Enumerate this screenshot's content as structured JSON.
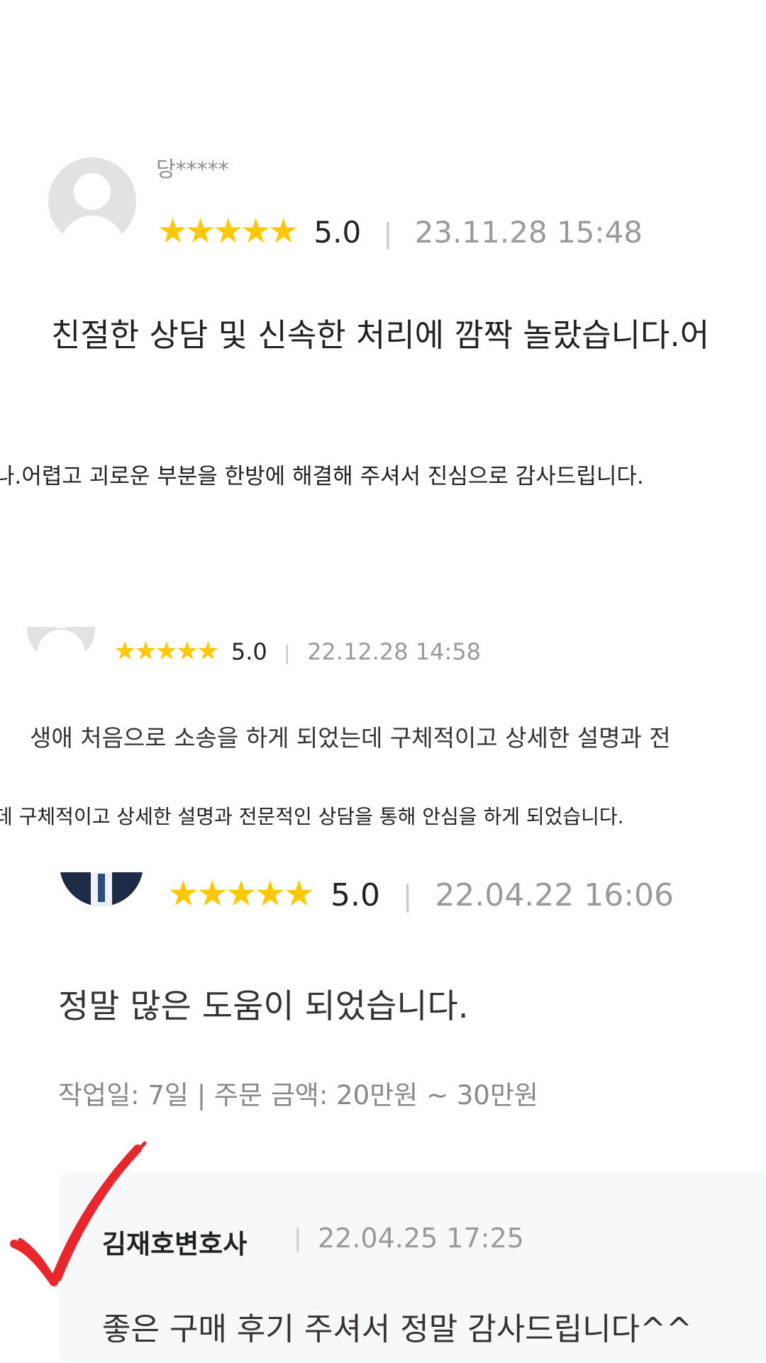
{
  "reviews": [
    {
      "username": "당*****",
      "stars": "★★★★★",
      "rating": "5.0",
      "separator": "|",
      "date": "23.11.28 15:48",
      "text": "친절한 상담 및 신속한 처리에 깜짝 놀랐습니다.어",
      "text_continued": "나.어렵고 괴로운 부분을 한방에 해결해 주셔서 진심으로 감사드립니다."
    },
    {
      "stars": "★★★★★",
      "rating": "5.0",
      "separator": "|",
      "date": "22.12.28 14:58",
      "text": "생애 처음으로 소송을 하게 되었는데 구체적이고 상세한 설명과 전",
      "text_continued": "데 구체적이고 상세한 설명과 전문적인 상담을 통해 안심을 하게 되었습니다."
    },
    {
      "stars": "★★★★★",
      "rating": "5.0",
      "separator": "|",
      "date": "22.04.22 16:06",
      "text": "정말 많은 도움이 되었습니다.",
      "meta": "작업일: 7일 | 주문 금액: 20만원 ~ 30만원",
      "reply": {
        "author": "김재호변호사",
        "separator": "|",
        "date": "22.04.25 17:25",
        "text": "좋은 구매 후기 주셔서 정말 감사드립니다^^"
      }
    }
  ],
  "colors": {
    "star": "#FFC800",
    "check": "#E8262B",
    "date": "#9a9a9a",
    "reply_bg": "#f7f8fa"
  }
}
